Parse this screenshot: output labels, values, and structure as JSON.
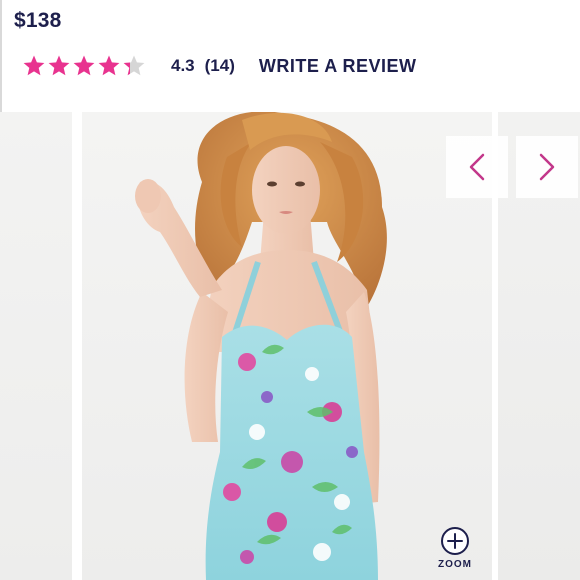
{
  "product": {
    "price": "$138"
  },
  "rating": {
    "value": 4.3,
    "value_text": "4.3",
    "count_text": "(14)",
    "max_stars": 5,
    "star_color": "#e8338f",
    "star_empty_color": "#d6d6d6"
  },
  "reviews": {
    "write_label": "WRITE A REVIEW"
  },
  "gallery": {
    "image_subject": "model-in-floral-one-piece-swimsuit",
    "prev_icon": "chevron-left-icon",
    "next_icon": "chevron-right-icon",
    "nav_color": "#c2378a",
    "zoom_icon": "plus-circle-icon",
    "zoom_label": "ZOOM"
  },
  "colors": {
    "text_primary": "#1d1f4c",
    "accent": "#e8338f"
  }
}
